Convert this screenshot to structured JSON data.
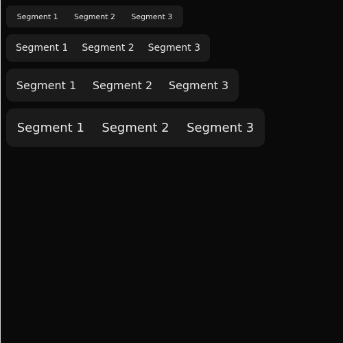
{
  "segmented_controls": [
    {
      "size": "xs",
      "segments": [
        "Segment 1",
        "Segment 2",
        "Segment 3"
      ]
    },
    {
      "size": "sm",
      "segments": [
        "Segment 1",
        "Segment 2",
        "Segment 3"
      ]
    },
    {
      "size": "md",
      "segments": [
        "Segment 1",
        "Segment 2",
        "Segment 3"
      ]
    },
    {
      "size": "lg",
      "segments": [
        "Segment 1",
        "Segment 2",
        "Segment 3"
      ]
    }
  ],
  "colors": {
    "background": "#0a0a0a",
    "control_background": "#1b1b1b",
    "text": "#e8e8e8"
  }
}
